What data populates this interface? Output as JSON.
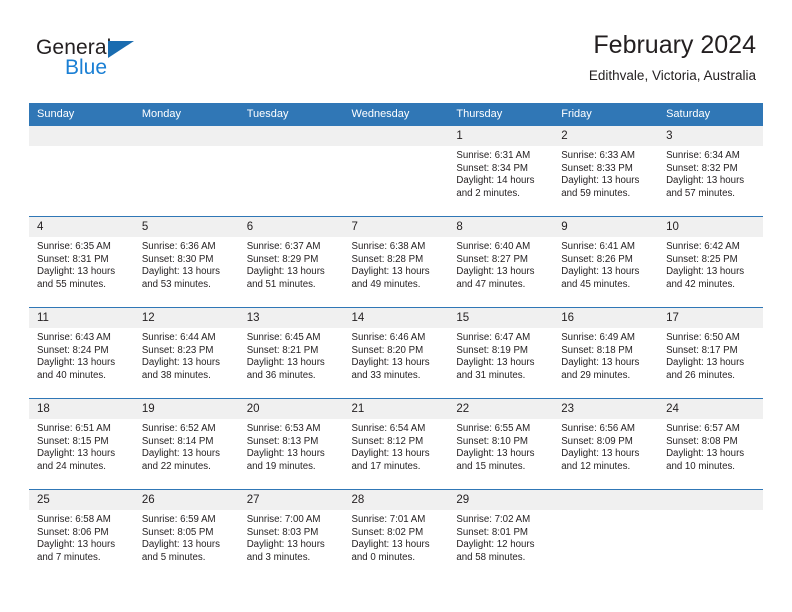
{
  "brand": {
    "name_top": "General",
    "name_bottom": "Blue",
    "triangle_color": "#1a6cb0",
    "blue_text_color": "#1a7fd4"
  },
  "header": {
    "title": "February 2024",
    "subtitle": "Edithvale, Victoria, Australia",
    "accent_color": "#3077b6",
    "daynum_band_color": "#f0f0f0"
  },
  "weekdays": [
    "Sunday",
    "Monday",
    "Tuesday",
    "Wednesday",
    "Thursday",
    "Friday",
    "Saturday"
  ],
  "weeks": [
    [
      {
        "day": "",
        "sunrise": "",
        "sunset": "",
        "daylight_1": "",
        "daylight_2": "",
        "empty": true
      },
      {
        "day": "",
        "sunrise": "",
        "sunset": "",
        "daylight_1": "",
        "daylight_2": "",
        "empty": true
      },
      {
        "day": "",
        "sunrise": "",
        "sunset": "",
        "daylight_1": "",
        "daylight_2": "",
        "empty": true
      },
      {
        "day": "",
        "sunrise": "",
        "sunset": "",
        "daylight_1": "",
        "daylight_2": "",
        "empty": true
      },
      {
        "day": "1",
        "sunrise": "Sunrise: 6:31 AM",
        "sunset": "Sunset: 8:34 PM",
        "daylight_1": "Daylight: 14 hours",
        "daylight_2": "and 2 minutes.",
        "empty": false
      },
      {
        "day": "2",
        "sunrise": "Sunrise: 6:33 AM",
        "sunset": "Sunset: 8:33 PM",
        "daylight_1": "Daylight: 13 hours",
        "daylight_2": "and 59 minutes.",
        "empty": false
      },
      {
        "day": "3",
        "sunrise": "Sunrise: 6:34 AM",
        "sunset": "Sunset: 8:32 PM",
        "daylight_1": "Daylight: 13 hours",
        "daylight_2": "and 57 minutes.",
        "empty": false
      }
    ],
    [
      {
        "day": "4",
        "sunrise": "Sunrise: 6:35 AM",
        "sunset": "Sunset: 8:31 PM",
        "daylight_1": "Daylight: 13 hours",
        "daylight_2": "and 55 minutes.",
        "empty": false
      },
      {
        "day": "5",
        "sunrise": "Sunrise: 6:36 AM",
        "sunset": "Sunset: 8:30 PM",
        "daylight_1": "Daylight: 13 hours",
        "daylight_2": "and 53 minutes.",
        "empty": false
      },
      {
        "day": "6",
        "sunrise": "Sunrise: 6:37 AM",
        "sunset": "Sunset: 8:29 PM",
        "daylight_1": "Daylight: 13 hours",
        "daylight_2": "and 51 minutes.",
        "empty": false
      },
      {
        "day": "7",
        "sunrise": "Sunrise: 6:38 AM",
        "sunset": "Sunset: 8:28 PM",
        "daylight_1": "Daylight: 13 hours",
        "daylight_2": "and 49 minutes.",
        "empty": false
      },
      {
        "day": "8",
        "sunrise": "Sunrise: 6:40 AM",
        "sunset": "Sunset: 8:27 PM",
        "daylight_1": "Daylight: 13 hours",
        "daylight_2": "and 47 minutes.",
        "empty": false
      },
      {
        "day": "9",
        "sunrise": "Sunrise: 6:41 AM",
        "sunset": "Sunset: 8:26 PM",
        "daylight_1": "Daylight: 13 hours",
        "daylight_2": "and 45 minutes.",
        "empty": false
      },
      {
        "day": "10",
        "sunrise": "Sunrise: 6:42 AM",
        "sunset": "Sunset: 8:25 PM",
        "daylight_1": "Daylight: 13 hours",
        "daylight_2": "and 42 minutes.",
        "empty": false
      }
    ],
    [
      {
        "day": "11",
        "sunrise": "Sunrise: 6:43 AM",
        "sunset": "Sunset: 8:24 PM",
        "daylight_1": "Daylight: 13 hours",
        "daylight_2": "and 40 minutes.",
        "empty": false
      },
      {
        "day": "12",
        "sunrise": "Sunrise: 6:44 AM",
        "sunset": "Sunset: 8:23 PM",
        "daylight_1": "Daylight: 13 hours",
        "daylight_2": "and 38 minutes.",
        "empty": false
      },
      {
        "day": "13",
        "sunrise": "Sunrise: 6:45 AM",
        "sunset": "Sunset: 8:21 PM",
        "daylight_1": "Daylight: 13 hours",
        "daylight_2": "and 36 minutes.",
        "empty": false
      },
      {
        "day": "14",
        "sunrise": "Sunrise: 6:46 AM",
        "sunset": "Sunset: 8:20 PM",
        "daylight_1": "Daylight: 13 hours",
        "daylight_2": "and 33 minutes.",
        "empty": false
      },
      {
        "day": "15",
        "sunrise": "Sunrise: 6:47 AM",
        "sunset": "Sunset: 8:19 PM",
        "daylight_1": "Daylight: 13 hours",
        "daylight_2": "and 31 minutes.",
        "empty": false
      },
      {
        "day": "16",
        "sunrise": "Sunrise: 6:49 AM",
        "sunset": "Sunset: 8:18 PM",
        "daylight_1": "Daylight: 13 hours",
        "daylight_2": "and 29 minutes.",
        "empty": false
      },
      {
        "day": "17",
        "sunrise": "Sunrise: 6:50 AM",
        "sunset": "Sunset: 8:17 PM",
        "daylight_1": "Daylight: 13 hours",
        "daylight_2": "and 26 minutes.",
        "empty": false
      }
    ],
    [
      {
        "day": "18",
        "sunrise": "Sunrise: 6:51 AM",
        "sunset": "Sunset: 8:15 PM",
        "daylight_1": "Daylight: 13 hours",
        "daylight_2": "and 24 minutes.",
        "empty": false
      },
      {
        "day": "19",
        "sunrise": "Sunrise: 6:52 AM",
        "sunset": "Sunset: 8:14 PM",
        "daylight_1": "Daylight: 13 hours",
        "daylight_2": "and 22 minutes.",
        "empty": false
      },
      {
        "day": "20",
        "sunrise": "Sunrise: 6:53 AM",
        "sunset": "Sunset: 8:13 PM",
        "daylight_1": "Daylight: 13 hours",
        "daylight_2": "and 19 minutes.",
        "empty": false
      },
      {
        "day": "21",
        "sunrise": "Sunrise: 6:54 AM",
        "sunset": "Sunset: 8:12 PM",
        "daylight_1": "Daylight: 13 hours",
        "daylight_2": "and 17 minutes.",
        "empty": false
      },
      {
        "day": "22",
        "sunrise": "Sunrise: 6:55 AM",
        "sunset": "Sunset: 8:10 PM",
        "daylight_1": "Daylight: 13 hours",
        "daylight_2": "and 15 minutes.",
        "empty": false
      },
      {
        "day": "23",
        "sunrise": "Sunrise: 6:56 AM",
        "sunset": "Sunset: 8:09 PM",
        "daylight_1": "Daylight: 13 hours",
        "daylight_2": "and 12 minutes.",
        "empty": false
      },
      {
        "day": "24",
        "sunrise": "Sunrise: 6:57 AM",
        "sunset": "Sunset: 8:08 PM",
        "daylight_1": "Daylight: 13 hours",
        "daylight_2": "and 10 minutes.",
        "empty": false
      }
    ],
    [
      {
        "day": "25",
        "sunrise": "Sunrise: 6:58 AM",
        "sunset": "Sunset: 8:06 PM",
        "daylight_1": "Daylight: 13 hours",
        "daylight_2": "and 7 minutes.",
        "empty": false
      },
      {
        "day": "26",
        "sunrise": "Sunrise: 6:59 AM",
        "sunset": "Sunset: 8:05 PM",
        "daylight_1": "Daylight: 13 hours",
        "daylight_2": "and 5 minutes.",
        "empty": false
      },
      {
        "day": "27",
        "sunrise": "Sunrise: 7:00 AM",
        "sunset": "Sunset: 8:03 PM",
        "daylight_1": "Daylight: 13 hours",
        "daylight_2": "and 3 minutes.",
        "empty": false
      },
      {
        "day": "28",
        "sunrise": "Sunrise: 7:01 AM",
        "sunset": "Sunset: 8:02 PM",
        "daylight_1": "Daylight: 13 hours",
        "daylight_2": "and 0 minutes.",
        "empty": false
      },
      {
        "day": "29",
        "sunrise": "Sunrise: 7:02 AM",
        "sunset": "Sunset: 8:01 PM",
        "daylight_1": "Daylight: 12 hours",
        "daylight_2": "and 58 minutes.",
        "empty": false
      },
      {
        "day": "",
        "sunrise": "",
        "sunset": "",
        "daylight_1": "",
        "daylight_2": "",
        "empty": true
      },
      {
        "day": "",
        "sunrise": "",
        "sunset": "",
        "daylight_1": "",
        "daylight_2": "",
        "empty": true
      }
    ]
  ]
}
